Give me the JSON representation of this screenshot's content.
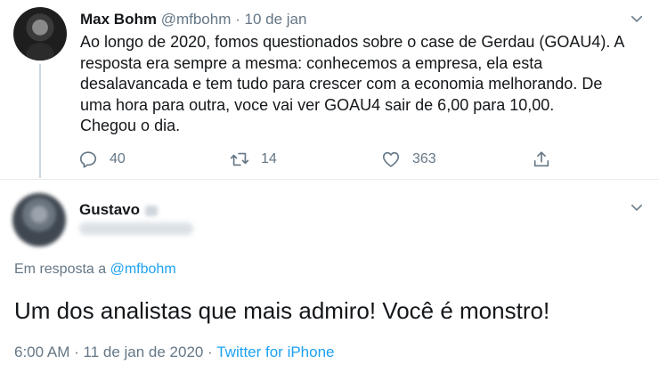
{
  "tweet": {
    "author_name": "Max Bohm",
    "handle": "@mfbohm",
    "separator": "·",
    "date": "10 de jan",
    "text": "Ao longo de 2020, fomos questionados sobre o case de Gerdau (GOAU4). A\nresposta era sempre a mesma: conhecemos a empresa, ela esta\ndesalavancada e tem tudo para crescer com a economia melhorando. De\numa hora para outra, voce vai ver GOAU4 sair de 6,00 para 10,00.\nChegou o dia.",
    "replies": "40",
    "retweets": "14",
    "likes": "363",
    "icons": [
      "reply-icon",
      "retweet-icon",
      "like-icon",
      "share-icon",
      "chevron-down-icon"
    ]
  },
  "reply": {
    "author_name": "Gustavo",
    "reply_prefix": "Em resposta a",
    "reply_to": "@mfbohm",
    "text": "Um dos analistas que mais admiro! Você é monstro!",
    "time": "6:00 AM",
    "separator": "·",
    "date": "11 de jan de 2020",
    "source": "Twitter for iPhone"
  },
  "colors": {
    "link": "#1da1f2",
    "muted": "#657786",
    "text": "#14171a",
    "divider": "#e6ecf0"
  }
}
